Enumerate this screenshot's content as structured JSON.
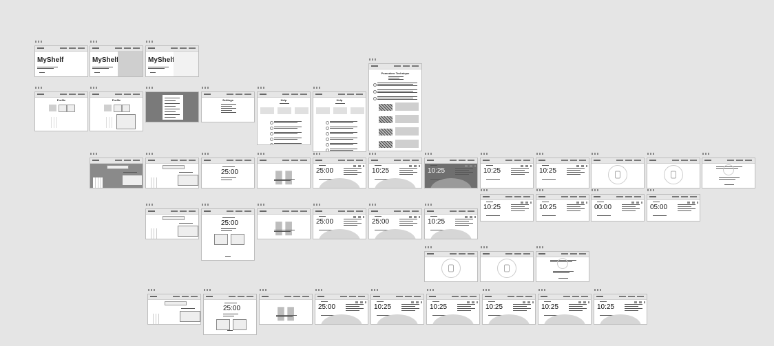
{
  "frames": [
    {
      "id": "hero-1",
      "variant": "hero",
      "heading": "MyShelf"
    },
    {
      "id": "hero-2",
      "variant": "hero",
      "heading": "MyShelf"
    },
    {
      "id": "hero-3",
      "variant": "hero",
      "heading": "MyShelf"
    },
    {
      "id": "pomodoro-tech",
      "variant": "article",
      "heading": "Pomodoro Technique"
    },
    {
      "id": "profile-1",
      "variant": "profile",
      "heading": "Profile"
    },
    {
      "id": "profile-2",
      "variant": "profile",
      "heading": "Profile"
    },
    {
      "id": "menu-dark",
      "variant": "menu"
    },
    {
      "id": "settings",
      "variant": "settings",
      "heading": "Settings"
    },
    {
      "id": "help-1",
      "variant": "help",
      "heading": "Help"
    },
    {
      "id": "help-2",
      "variant": "help",
      "heading": "Help"
    },
    {
      "id": "r3-1",
      "variant": "shelf-dark"
    },
    {
      "id": "r3-2",
      "variant": "shelf"
    },
    {
      "id": "r3-3",
      "variant": "timer",
      "time": "25:00"
    },
    {
      "id": "r3-4",
      "variant": "book"
    },
    {
      "id": "r3-5",
      "variant": "timer-arc",
      "time": "25:00"
    },
    {
      "id": "r3-6",
      "variant": "timer-arc",
      "time": "10:25"
    },
    {
      "id": "r3-7",
      "variant": "timer-arc-dark",
      "time": "10:25"
    },
    {
      "id": "r3-8",
      "variant": "timer-list",
      "time": "10:25"
    },
    {
      "id": "r3-9",
      "variant": "timer-list",
      "time": "10:25"
    },
    {
      "id": "r3-10",
      "variant": "circle"
    },
    {
      "id": "r3-11",
      "variant": "circle"
    },
    {
      "id": "r3-12",
      "variant": "summary"
    },
    {
      "id": "r3b-1",
      "variant": "timer-list",
      "time": "10:25"
    },
    {
      "id": "r3b-2",
      "variant": "timer-list",
      "time": "10:25"
    },
    {
      "id": "r3b-3",
      "variant": "timer-list",
      "time": "00:00"
    },
    {
      "id": "r3b-4",
      "variant": "timer-list",
      "time": "05:00"
    },
    {
      "id": "r4-1",
      "variant": "shelf"
    },
    {
      "id": "r4-2",
      "variant": "timer-form",
      "time": "25:00"
    },
    {
      "id": "r4-3",
      "variant": "book"
    },
    {
      "id": "r4-4",
      "variant": "timer-arc",
      "time": "25:00"
    },
    {
      "id": "r4-5",
      "variant": "timer-arc",
      "time": "25:00"
    },
    {
      "id": "r4-6",
      "variant": "timer-arc",
      "time": "10:25"
    },
    {
      "id": "r5-1",
      "variant": "circle"
    },
    {
      "id": "r5-2",
      "variant": "circle"
    },
    {
      "id": "r5-3",
      "variant": "summary"
    },
    {
      "id": "r6-1",
      "variant": "shelf"
    },
    {
      "id": "r6-2",
      "variant": "timer-form",
      "time": "25:00"
    },
    {
      "id": "r6-3",
      "variant": "book"
    },
    {
      "id": "r6-4",
      "variant": "timer-arc",
      "time": "25:00"
    },
    {
      "id": "r6-5",
      "variant": "timer-arc",
      "time": "10:25"
    },
    {
      "id": "r6-6",
      "variant": "timer-arc",
      "time": "10:25"
    },
    {
      "id": "r6-7",
      "variant": "timer-arc",
      "time": "10:25"
    },
    {
      "id": "r6-8",
      "variant": "timer-arc",
      "time": "10:25"
    },
    {
      "id": "r6-9",
      "variant": "timer-arc",
      "time": "10:25"
    }
  ]
}
